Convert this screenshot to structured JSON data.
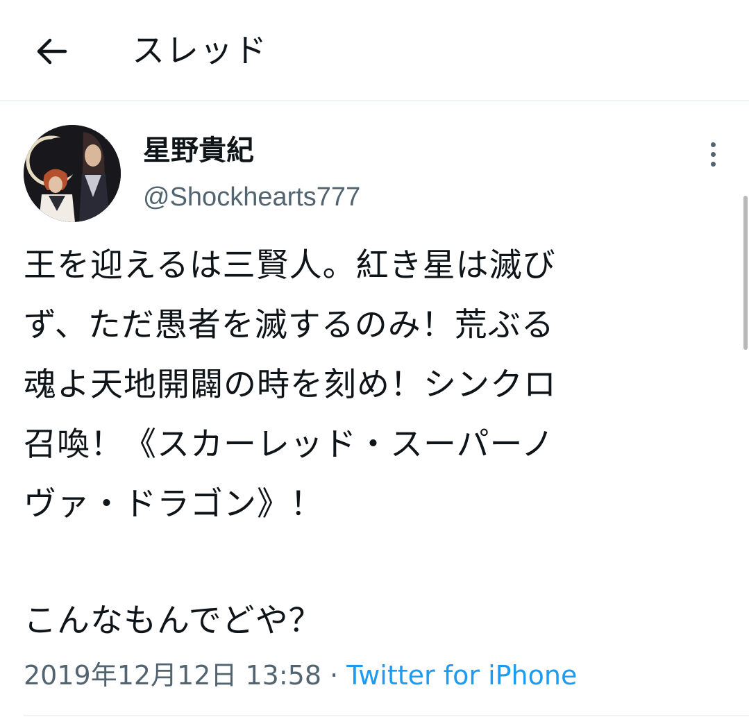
{
  "header": {
    "title": "スレッド",
    "back_icon": "arrow-left-icon"
  },
  "tweet": {
    "display_name": "星野貴紀",
    "handle": "@Shockhearts777",
    "avatar_icon": "user-avatar",
    "more_icon": "more-vertical-icon",
    "body_lines": [
      "王を迎えるは三賢人。紅き星は滅び",
      "ず、ただ愚者を滅するのみ！荒ぶる",
      "魂よ天地開闢の時を刻め！シンクロ",
      "召喚！《スカーレッド・スーパーノ",
      "ヴァ・ドラゴン》！"
    ],
    "body_tail": "こんなもんでどや？",
    "timestamp": "2019年12月12日 13:58",
    "separator": "·",
    "source": "Twitter for iPhone"
  },
  "colors": {
    "text": "#0f1419",
    "secondary": "#536471",
    "link": "#1d9bf0",
    "divider": "#eff3f4"
  }
}
